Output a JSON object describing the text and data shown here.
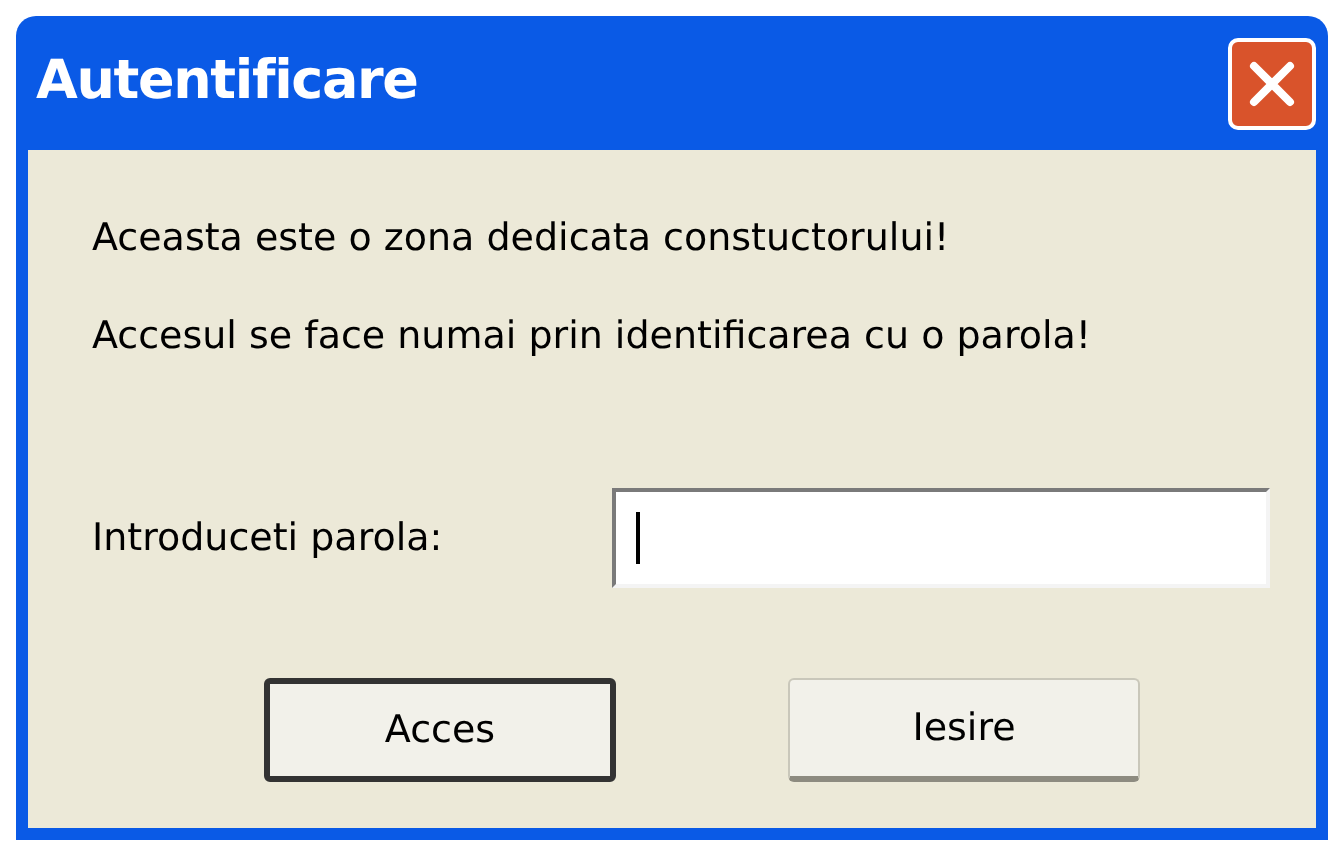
{
  "window": {
    "title": "Autentificare"
  },
  "messages": [
    "Aceasta este o zona dedicata constuctorului!",
    "Accesul se face numai prin identificarea cu o parola!"
  ],
  "password": {
    "label": "Introduceti parola:",
    "focused": true
  },
  "buttons": [
    {
      "label": "Acces",
      "default": true
    },
    {
      "label": "Iesire",
      "default": false
    }
  ]
}
